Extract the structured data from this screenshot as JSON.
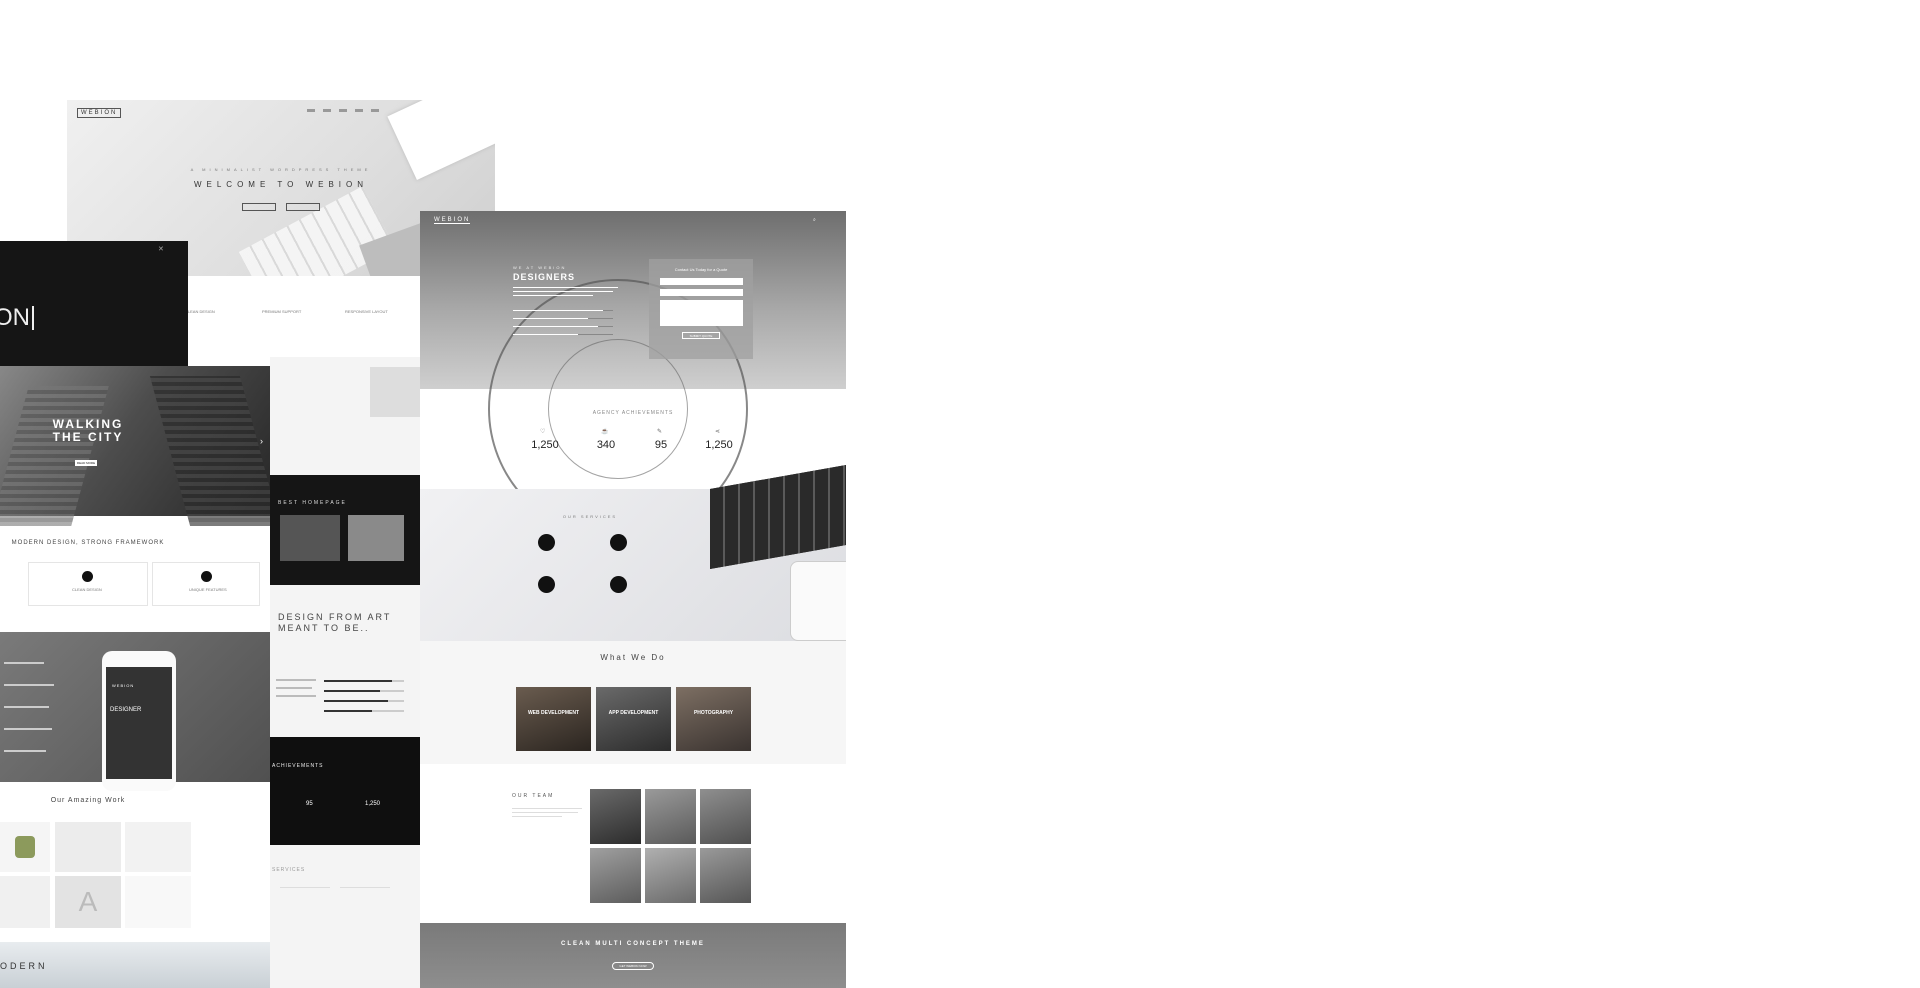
{
  "card1": {
    "logo": "WEBION",
    "tagline": "A MINIMALIST WORDPRESS THEME",
    "welcome": "WELCOME TO WEBION",
    "features": [
      "CLEAN DESIGN",
      "PREMIUM SUPPORT",
      "RESPONSIVE LAYOUT"
    ]
  },
  "card2": {
    "text": "ON"
  },
  "card3": {
    "title_line1": "WALKING",
    "title_line2": "THE CITY",
    "btn": "READ MORE",
    "framework": "MODERN DESIGN, STRONG FRAMEWORK",
    "features": [
      "CLEAN DESIGN",
      "UNIQUE FEATURES"
    ],
    "amazing": "Our Amazing Work",
    "modern": "ODERN",
    "phone_logo": "WEBION",
    "phone_title": "DESIGNER"
  },
  "card4": {
    "homepage": "BEST HOMEPAGE",
    "design_line1": "DESIGN FROM ART",
    "design_line2": "MEANT TO BE..",
    "achievements": "ACHIEVEMENTS",
    "ach_numbers": [
      "95",
      "1,250"
    ],
    "services": "SERVICES"
  },
  "card5": {
    "logo": "WEBION",
    "subtitle": "WE AT WEBION",
    "title": "DESIGNERS",
    "contact_title": "Contact Us Today for a Quote",
    "form_button": "SUBMIT QUOTE",
    "achievements_title": "AGENCY ACHIEVEMENTS",
    "stats": [
      {
        "value": "1,250"
      },
      {
        "value": "340"
      },
      {
        "value": "95"
      },
      {
        "value": "1,250"
      }
    ],
    "services_title": "OUR SERVICES",
    "whatwedo": "What We Do",
    "projects": [
      "WEB DEVELOPMENT",
      "APP DEVELOPMENT",
      "PHOTOGRAPHY"
    ],
    "team_title": "OUR TEAM",
    "clean": "CLEAN MULTI CONCEPT THEME",
    "clean_btn": "GET WEBION NOW"
  },
  "colors": {
    "dark": "#111111",
    "mid": "#7a7a7a",
    "light": "#efefef",
    "accent": "#222222"
  }
}
